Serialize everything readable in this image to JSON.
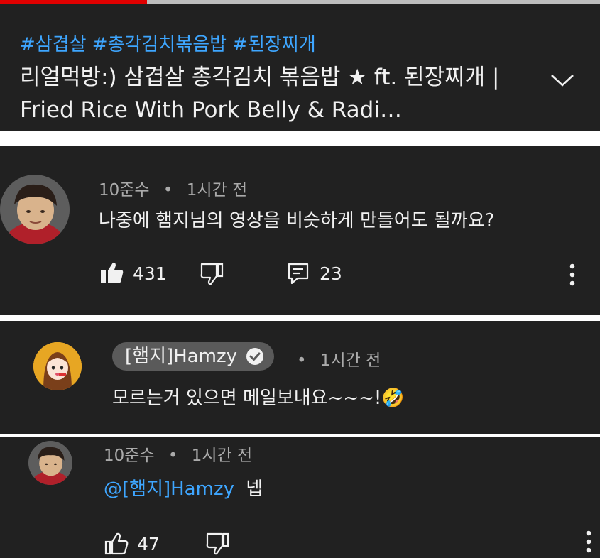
{
  "video": {
    "hashtags": "#삼겹살 #총각김치볶음밥 #된장찌개",
    "title": "리얼먹방:) 삼겹살 총각김치 볶음밥 ★ ft. 된장찌개 | Fried Rice With Pork Belly & Radi…",
    "progress_fraction": 0.245
  },
  "comments": [
    {
      "author": "10준수",
      "time": "1시간 전",
      "text": "나중에 햄지님의 영상을 비슷하게 만들어도 될까요?",
      "likes": "431",
      "replies": "23"
    },
    {
      "author": "[햄지]Hamzy",
      "time": "1시간 전",
      "text": "모르는거 있으면 메일보내요~~~!🤣"
    },
    {
      "author": "10준수",
      "time": "1시간 전",
      "mention": "@[햄지]Hamzy",
      "text": "넵",
      "likes": "47"
    }
  ],
  "separator": "•",
  "icons": [
    "thumbs-up-icon",
    "thumbs-down-icon",
    "reply-icon",
    "more-vert-icon",
    "chevron-down-icon",
    "verified-check-icon"
  ],
  "colors": {
    "background": "#212121",
    "link": "#3ea6ff",
    "secondary_text": "#aaaaaa",
    "progress": "#e00000"
  }
}
